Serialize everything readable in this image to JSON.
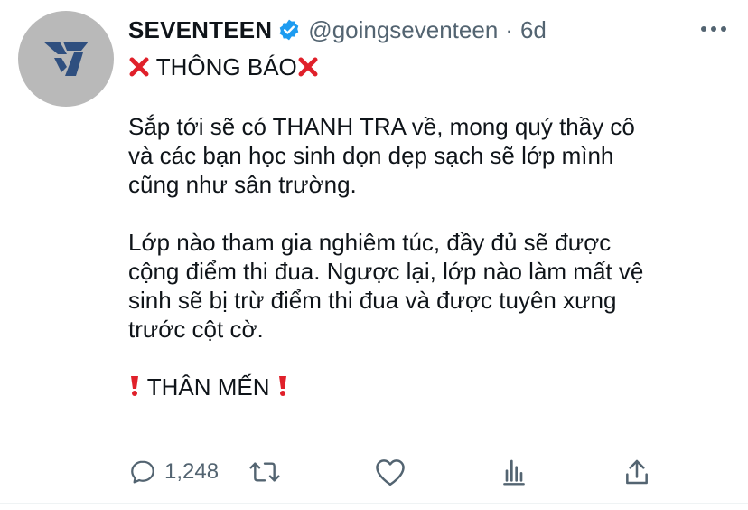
{
  "tweet": {
    "display_name": "SEVENTEEN",
    "handle": "@goingseventeen",
    "separator": "·",
    "time": "6d",
    "heading_text": " THÔNG BÁO",
    "paragraph1": [
      "Sắp tới sẽ có THANH TRA về, mong quý thầy cô",
      "và các bạn học sinh dọn dẹp sạch sẽ lớp mình",
      "cũng như sân trường."
    ],
    "paragraph2": [
      "Lớp nào tham gia nghiêm túc, đầy đủ sẽ được",
      "cộng điểm thi đua. Ngược lại, lớp nào làm mất vệ",
      "sinh sẽ bị trừ điểm thi đua và được tuyên xưng",
      "trước cột cờ."
    ],
    "closing_text": " THÂN MẾN "
  },
  "actions": {
    "reply_count": "1,248"
  },
  "colors": {
    "verified": "#1d9bf0",
    "secondary_text": "#536471",
    "cross_mark": "#e0202a",
    "exclamation": "#e0202a",
    "avatar_bg": "#b9b9b9",
    "logo": "#2f4f7f"
  },
  "icons": {
    "verified": "verified-badge-icon",
    "more": "more-icon",
    "reply": "reply-icon",
    "retweet": "retweet-icon",
    "like": "heart-icon",
    "analytics": "analytics-icon",
    "share": "share-icon",
    "cross": "cross-mark-icon",
    "exclamation": "exclamation-icon"
  }
}
